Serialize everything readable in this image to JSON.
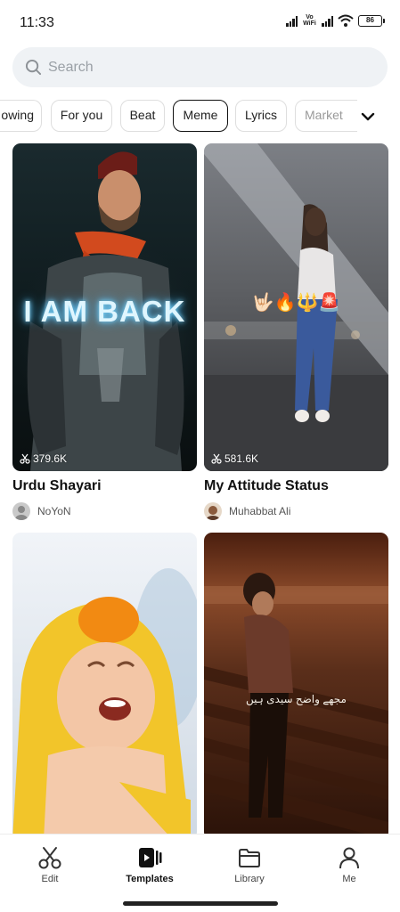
{
  "status_bar": {
    "time": "11:33",
    "vo": "Vo",
    "wifi_label": "WiFi",
    "battery": "86"
  },
  "search": {
    "placeholder": "Search"
  },
  "categories": [
    {
      "label": "owing"
    },
    {
      "label": "For you"
    },
    {
      "label": "Beat"
    },
    {
      "label": "Meme",
      "selected": true
    },
    {
      "label": "Lyrics"
    },
    {
      "label": "Market"
    }
  ],
  "templates": [
    {
      "title": "Urdu Shayari",
      "uses": "379.6K",
      "author": "NoYoN",
      "overlay_text": "I AM BACK"
    },
    {
      "title": "My Attitude Status",
      "uses": "581.6K",
      "author": "Muhabbat Ali",
      "overlay_text": "🤟🏻🔥🔱🚨"
    },
    {
      "title": "",
      "uses": "",
      "author": ""
    },
    {
      "title": "",
      "uses": "",
      "author": "",
      "overlay_text": "مجھے واضح سیدی ہیں"
    }
  ],
  "nav": [
    {
      "label": "Edit",
      "icon": "scissors-icon"
    },
    {
      "label": "Templates",
      "icon": "templates-icon",
      "active": true
    },
    {
      "label": "Library",
      "icon": "folder-icon"
    },
    {
      "label": "Me",
      "icon": "person-icon"
    }
  ],
  "colors": {
    "accent": "#111111",
    "chip_border": "#dedede",
    "search_bg": "#eff2f5"
  }
}
